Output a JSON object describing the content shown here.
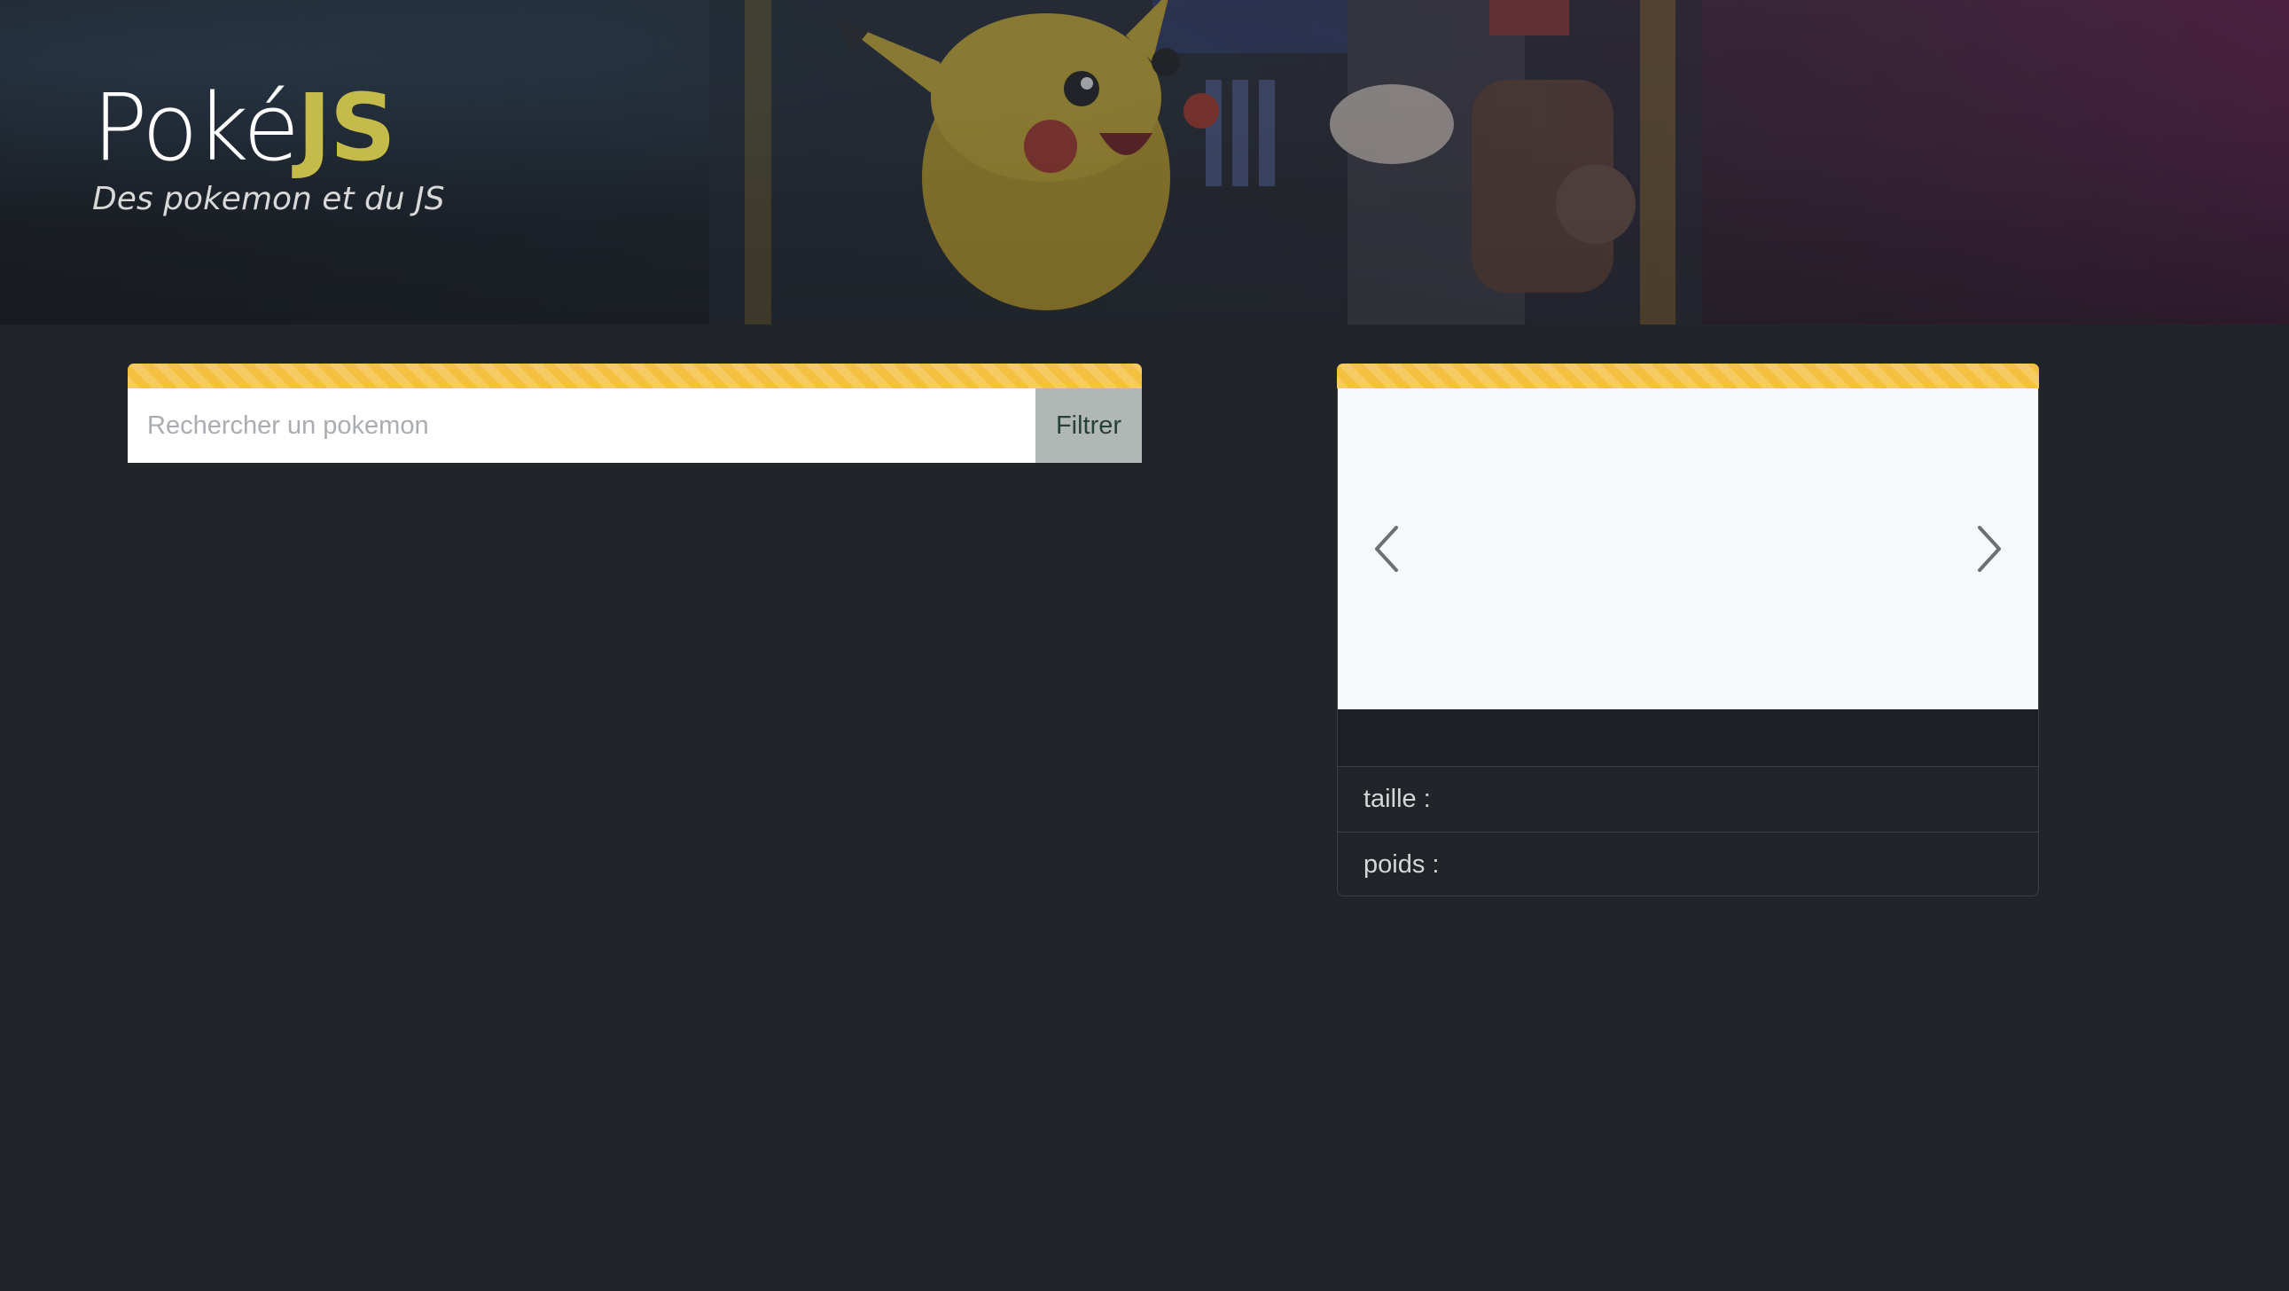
{
  "header": {
    "title_prefix": "Poké",
    "title_accent": "JS",
    "tagline": "Des pokemon et du JS"
  },
  "search": {
    "placeholder": "Rechercher un pokemon",
    "value": "",
    "button_label": "Filtrer"
  },
  "card": {
    "name": "",
    "stats": [
      {
        "label": "taille :"
      },
      {
        "label": "poids :"
      }
    ]
  },
  "icons": {
    "carousel_prev": "chevron-left-icon",
    "carousel_next": "chevron-right-icon"
  },
  "colors": {
    "background": "#212529",
    "accent_yellow": "#f4c03f",
    "title_accent": "#c5bb4b",
    "button_bg": "#b0b7b4"
  }
}
